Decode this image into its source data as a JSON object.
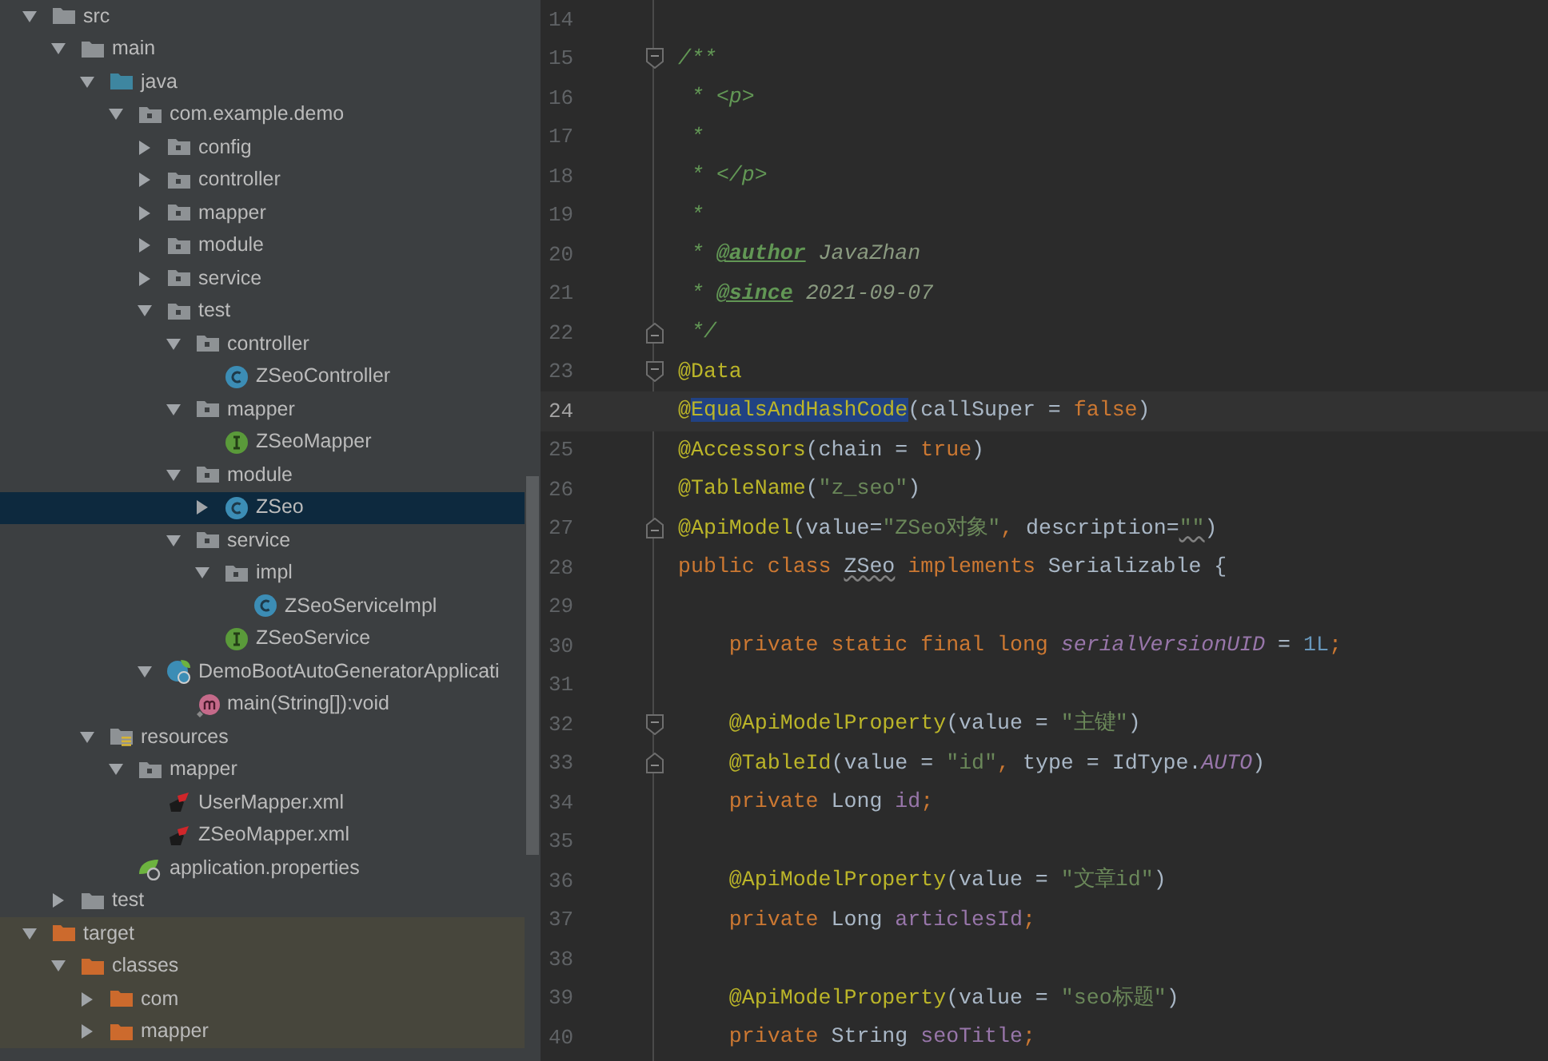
{
  "project_tree": [
    {
      "label": "src",
      "kind": "folder",
      "expanded": true,
      "selected": false,
      "children": [
        {
          "label": "main",
          "kind": "folder",
          "expanded": true,
          "selected": false,
          "children": [
            {
              "label": "java",
              "kind": "source-root",
              "expanded": true,
              "selected": false,
              "children": [
                {
                  "label": "com.example.demo",
                  "kind": "package",
                  "expanded": true,
                  "selected": false,
                  "children": [
                    {
                      "label": "config",
                      "kind": "package",
                      "expanded": false,
                      "selected": false
                    },
                    {
                      "label": "controller",
                      "kind": "package",
                      "expanded": false,
                      "selected": false
                    },
                    {
                      "label": "mapper",
                      "kind": "package",
                      "expanded": false,
                      "selected": false
                    },
                    {
                      "label": "module",
                      "kind": "package",
                      "expanded": false,
                      "selected": false
                    },
                    {
                      "label": "service",
                      "kind": "package",
                      "expanded": false,
                      "selected": false
                    },
                    {
                      "label": "test",
                      "kind": "package",
                      "expanded": true,
                      "selected": false,
                      "children": [
                        {
                          "label": "controller",
                          "kind": "package",
                          "expanded": true,
                          "selected": false,
                          "children": [
                            {
                              "label": "ZSeoController",
                              "kind": "class",
                              "selected": false
                            }
                          ]
                        },
                        {
                          "label": "mapper",
                          "kind": "package",
                          "expanded": true,
                          "selected": false,
                          "children": [
                            {
                              "label": "ZSeoMapper",
                              "kind": "interface",
                              "selected": false
                            }
                          ]
                        },
                        {
                          "label": "module",
                          "kind": "package",
                          "expanded": true,
                          "selected": false,
                          "children": [
                            {
                              "label": "ZSeo",
                              "kind": "class",
                              "expanded": false,
                              "selected": true
                            }
                          ]
                        },
                        {
                          "label": "service",
                          "kind": "package",
                          "expanded": true,
                          "selected": false,
                          "children": [
                            {
                              "label": "impl",
                              "kind": "package",
                              "expanded": true,
                              "selected": false,
                              "children": [
                                {
                                  "label": "ZSeoServiceImpl",
                                  "kind": "class",
                                  "selected": false
                                }
                              ]
                            },
                            {
                              "label": "ZSeoService",
                              "kind": "interface",
                              "selected": false
                            }
                          ]
                        }
                      ]
                    },
                    {
                      "label": "DemoBootAutoGeneratorApplicati",
                      "kind": "spring-class",
                      "expanded": true,
                      "selected": false,
                      "children": [
                        {
                          "label": "main(String[]):void",
                          "kind": "method",
                          "selected": false
                        }
                      ]
                    }
                  ]
                }
              ]
            },
            {
              "label": "resources",
              "kind": "resource-root",
              "expanded": true,
              "selected": false,
              "children": [
                {
                  "label": "mapper",
                  "kind": "package",
                  "expanded": true,
                  "selected": false,
                  "children": [
                    {
                      "label": "UserMapper.xml",
                      "kind": "xml",
                      "selected": false
                    },
                    {
                      "label": "ZSeoMapper.xml",
                      "kind": "xml",
                      "selected": false
                    }
                  ]
                },
                {
                  "label": "application.properties",
                  "kind": "properties",
                  "selected": false
                }
              ]
            }
          ]
        },
        {
          "label": "test",
          "kind": "folder",
          "expanded": false,
          "selected": false
        }
      ]
    },
    {
      "label": "target",
      "kind": "excluded-folder",
      "expanded": true,
      "selected": false,
      "children": [
        {
          "label": "classes",
          "kind": "excluded-folder",
          "expanded": true,
          "selected": false,
          "children": [
            {
              "label": "com",
              "kind": "excluded-folder",
              "expanded": false,
              "selected": false
            },
            {
              "label": "mapper",
              "kind": "excluded-folder",
              "expanded": false,
              "selected": false
            }
          ]
        }
      ]
    }
  ],
  "editor": {
    "lines": [
      {
        "number": "14",
        "current": false,
        "kind": "plain"
      },
      {
        "number": "15",
        "current": false,
        "kind": "fold-start",
        "tokens": [
          {
            "text": "/**",
            "kind": "doc"
          }
        ]
      },
      {
        "number": "16",
        "current": false,
        "kind": "plain",
        "tokens": [
          {
            "text": " * <p>",
            "kind": "doc"
          }
        ]
      },
      {
        "number": "17",
        "current": false,
        "kind": "plain",
        "tokens": [
          {
            "text": " *",
            "kind": "doc"
          }
        ]
      },
      {
        "number": "18",
        "current": false,
        "kind": "plain",
        "tokens": [
          {
            "text": " * </p>",
            "kind": "doc"
          }
        ]
      },
      {
        "number": "19",
        "current": false,
        "kind": "plain",
        "tokens": [
          {
            "text": " *",
            "kind": "doc"
          }
        ]
      },
      {
        "number": "20",
        "current": false,
        "kind": "plain",
        "tokens": [
          {
            "text": " * ",
            "kind": "doc"
          },
          {
            "text": "@author",
            "kind": "doctag"
          },
          {
            "text": " JavaZhan",
            "kind": "docvalue"
          }
        ]
      },
      {
        "number": "21",
        "current": false,
        "kind": "plain",
        "tokens": [
          {
            "text": " * ",
            "kind": "doc"
          },
          {
            "text": "@since",
            "kind": "doctag"
          },
          {
            "text": " 2021-09-07",
            "kind": "docvalue"
          }
        ]
      },
      {
        "number": "22",
        "current": false,
        "kind": "fold-end",
        "tokens": [
          {
            "text": " */",
            "kind": "doc"
          }
        ]
      },
      {
        "number": "23",
        "current": false,
        "kind": "fold-start",
        "tokens": [
          {
            "text": "@Data",
            "kind": "annotation"
          }
        ]
      },
      {
        "number": "24",
        "current": true,
        "kind": "plain",
        "tokens": [
          {
            "text": "@",
            "kind": "annotation"
          },
          {
            "text": "EqualsAndHashCode",
            "kind": "annotation",
            "selected": true
          },
          {
            "text": "(callSuper = ",
            "kind": "plain"
          },
          {
            "text": "false",
            "kind": "keyword"
          },
          {
            "text": ")",
            "kind": "plain"
          }
        ]
      },
      {
        "number": "25",
        "current": false,
        "kind": "plain",
        "tokens": [
          {
            "text": "@Accessors",
            "kind": "annotation"
          },
          {
            "text": "(chain = ",
            "kind": "plain"
          },
          {
            "text": "true",
            "kind": "keyword"
          },
          {
            "text": ")",
            "kind": "plain"
          }
        ]
      },
      {
        "number": "26",
        "current": false,
        "kind": "plain",
        "tokens": [
          {
            "text": "@TableName",
            "kind": "annotation"
          },
          {
            "text": "(",
            "kind": "plain"
          },
          {
            "text": "\"z_seo\"",
            "kind": "string"
          },
          {
            "text": ")",
            "kind": "plain"
          }
        ]
      },
      {
        "number": "27",
        "current": false,
        "kind": "fold-end",
        "tokens": [
          {
            "text": "@ApiModel",
            "kind": "annotation"
          },
          {
            "text": "(value=",
            "kind": "plain"
          },
          {
            "text": "\"ZSeo对象\"",
            "kind": "string"
          },
          {
            "text": ", ",
            "kind": "keyword"
          },
          {
            "text": "description=",
            "kind": "plain"
          },
          {
            "text": "\"\"",
            "kind": "string-typo"
          },
          {
            "text": ")",
            "kind": "plain"
          }
        ]
      },
      {
        "number": "28",
        "current": false,
        "kind": "plain",
        "tokens": [
          {
            "text": "public class ",
            "kind": "keyword"
          },
          {
            "text": "ZSeo",
            "kind": "typo"
          },
          {
            "text": " implements ",
            "kind": "keyword"
          },
          {
            "text": "Serializable {",
            "kind": "plain"
          }
        ]
      },
      {
        "number": "29",
        "current": false,
        "kind": "plain"
      },
      {
        "number": "30",
        "current": false,
        "kind": "plain",
        "tokens": [
          {
            "text": "    private static final long ",
            "kind": "keyword"
          },
          {
            "text": "serialVersionUID",
            "kind": "static-field"
          },
          {
            "text": " = ",
            "kind": "plain"
          },
          {
            "text": "1L",
            "kind": "number"
          },
          {
            "text": ";",
            "kind": "keyword"
          }
        ]
      },
      {
        "number": "31",
        "current": false,
        "kind": "plain"
      },
      {
        "number": "32",
        "current": false,
        "kind": "fold-start",
        "tokens": [
          {
            "text": "    @ApiModelProperty",
            "kind": "annotation"
          },
          {
            "text": "(value = ",
            "kind": "plain"
          },
          {
            "text": "\"主键\"",
            "kind": "string"
          },
          {
            "text": ")",
            "kind": "plain"
          }
        ]
      },
      {
        "number": "33",
        "current": false,
        "kind": "fold-end",
        "tokens": [
          {
            "text": "    @TableId",
            "kind": "annotation"
          },
          {
            "text": "(value = ",
            "kind": "plain"
          },
          {
            "text": "\"id\"",
            "kind": "string"
          },
          {
            "text": ", ",
            "kind": "keyword"
          },
          {
            "text": "type = IdType.",
            "kind": "plain"
          },
          {
            "text": "AUTO",
            "kind": "static-field"
          },
          {
            "text": ")",
            "kind": "plain"
          }
        ]
      },
      {
        "number": "34",
        "current": false,
        "kind": "plain",
        "tokens": [
          {
            "text": "    private ",
            "kind": "keyword"
          },
          {
            "text": "Long ",
            "kind": "plain"
          },
          {
            "text": "id",
            "kind": "field"
          },
          {
            "text": ";",
            "kind": "keyword"
          }
        ]
      },
      {
        "number": "35",
        "current": false,
        "kind": "plain"
      },
      {
        "number": "36",
        "current": false,
        "kind": "plain",
        "tokens": [
          {
            "text": "    @ApiModelProperty",
            "kind": "annotation"
          },
          {
            "text": "(value = ",
            "kind": "plain"
          },
          {
            "text": "\"文章id\"",
            "kind": "string"
          },
          {
            "text": ")",
            "kind": "plain"
          }
        ]
      },
      {
        "number": "37",
        "current": false,
        "kind": "plain",
        "tokens": [
          {
            "text": "    private ",
            "kind": "keyword"
          },
          {
            "text": "Long ",
            "kind": "plain"
          },
          {
            "text": "articlesId",
            "kind": "field"
          },
          {
            "text": ";",
            "kind": "keyword"
          }
        ]
      },
      {
        "number": "38",
        "current": false,
        "kind": "plain"
      },
      {
        "number": "39",
        "current": false,
        "kind": "plain",
        "tokens": [
          {
            "text": "    @ApiModelProperty",
            "kind": "annotation"
          },
          {
            "text": "(value = ",
            "kind": "plain"
          },
          {
            "text": "\"seo标题\"",
            "kind": "string"
          },
          {
            "text": ")",
            "kind": "plain"
          }
        ]
      },
      {
        "number": "40",
        "current": false,
        "kind": "plain",
        "tokens": [
          {
            "text": "    private ",
            "kind": "keyword"
          },
          {
            "text": "String ",
            "kind": "plain"
          },
          {
            "text": "seoTitle",
            "kind": "field"
          },
          {
            "text": ";",
            "kind": "keyword"
          }
        ]
      }
    ]
  }
}
